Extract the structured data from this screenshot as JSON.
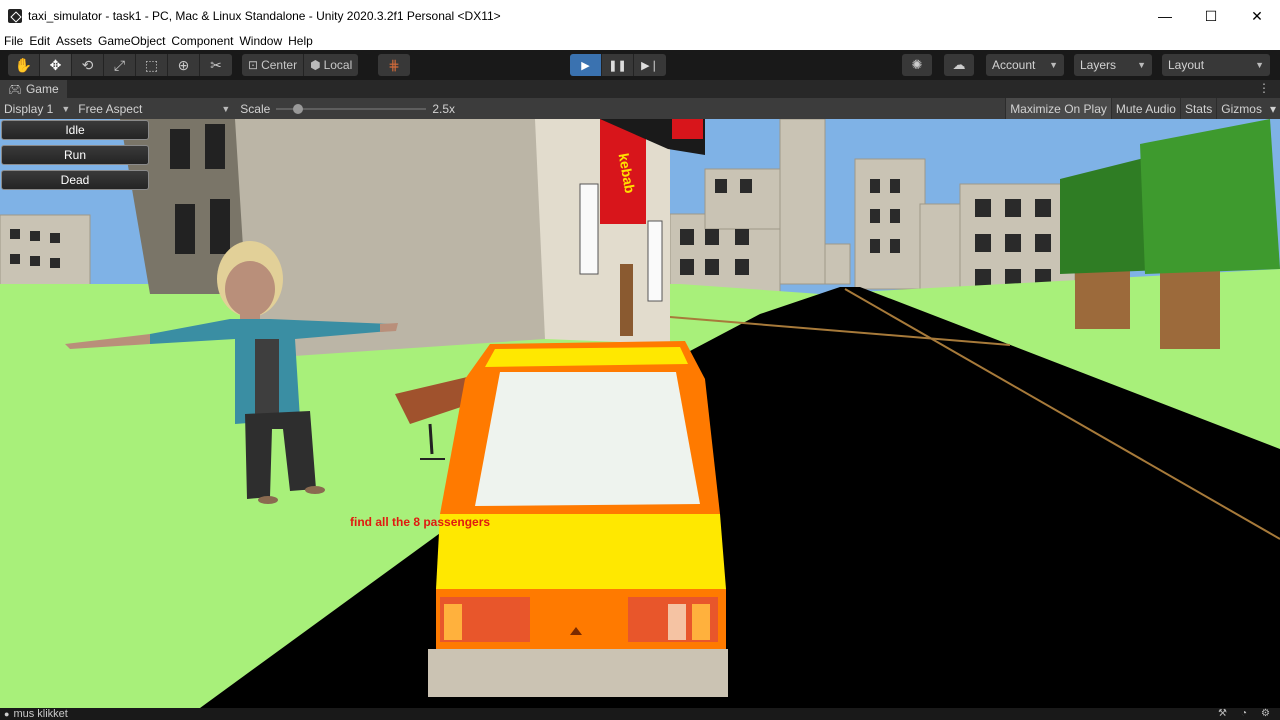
{
  "window": {
    "title": "taxi_simulator - task1 - PC, Mac & Linux Standalone - Unity 2020.3.2f1 Personal <DX11>",
    "minimize": "—",
    "maximize": "☐",
    "close": "✕"
  },
  "menu": [
    "File",
    "Edit",
    "Assets",
    "GameObject",
    "Component",
    "Window",
    "Help"
  ],
  "toolbar": {
    "tools": [
      {
        "name": "hand-tool",
        "glyph": "✋"
      },
      {
        "name": "move-tool",
        "glyph": "✥"
      },
      {
        "name": "rotate-tool",
        "glyph": "⟲"
      },
      {
        "name": "scale-tool",
        "glyph": "⤢"
      },
      {
        "name": "rect-tool",
        "glyph": "⬚"
      },
      {
        "name": "transform-tool",
        "glyph": "⊕"
      },
      {
        "name": "custom-tool",
        "glyph": "✂"
      }
    ],
    "pivot_label": "Center",
    "space_label": "Local",
    "account_label": "Account",
    "layers_label": "Layers",
    "layout_label": "Layout"
  },
  "tab": {
    "label": "Game"
  },
  "game_toolbar": {
    "display": "Display 1",
    "aspect": "Free Aspect",
    "scale_label": "Scale",
    "scale_value": "2.5x",
    "scale_fraction": 0.12,
    "maximize": "Maximize On Play",
    "mute": "Mute Audio",
    "stats": "Stats",
    "gizmos": "Gizmos"
  },
  "game": {
    "buttons": [
      "Idle",
      "Run",
      "Dead"
    ],
    "hint": "find all the 8 passengers",
    "shop_sign": "kebab",
    "colors": {
      "sky": "#7fb2e6",
      "grass": "#a8f07a",
      "road": "#000000",
      "taxi_body": "#ffe800",
      "taxi_trim": "#ff7a00",
      "sign": "#d8151b"
    }
  },
  "status": {
    "message": "mus klikket"
  }
}
